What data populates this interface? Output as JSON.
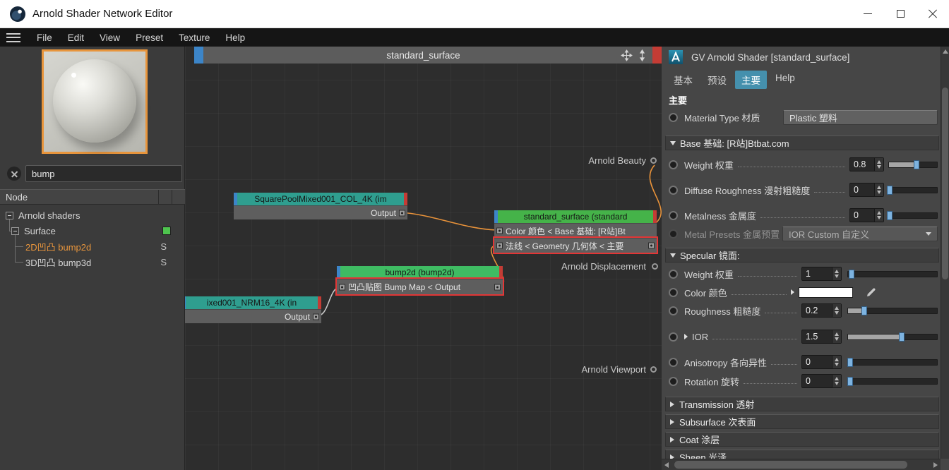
{
  "window": {
    "title": "Arnold Shader Network Editor"
  },
  "menu": {
    "items": [
      "File",
      "Edit",
      "View",
      "Preset",
      "Texture",
      "Help"
    ]
  },
  "left_panel": {
    "search_value": "bump",
    "tree_header": "Node",
    "tree": [
      {
        "label": "Arnold shaders"
      },
      {
        "label": "Surface",
        "swatch_color": "#4ec44e"
      },
      {
        "label": "2D凹凸 bump2d",
        "badge": "S",
        "color": "#e8953c"
      },
      {
        "label": "3D凹凸 bump3d",
        "badge": "S"
      }
    ]
  },
  "graph": {
    "header_title": "standard_surface",
    "nodes": {
      "color_tex": {
        "title": "SquarePoolMixed001_COL_4K (im",
        "output": "Output"
      },
      "standard_surface": {
        "title": "standard_surface (standard",
        "row_color": "Color 颜色 < Base 基础: [R站]Bt",
        "row_normal": "法线 < Geometry 几何体 < 主要"
      },
      "bump2d": {
        "title": "bump2d (bump2d)",
        "row": "凹凸贴图 Bump Map <  Output"
      },
      "normal_tex": {
        "title": "ixed001_NRM16_4K (in",
        "output": "Output"
      }
    },
    "outputs": [
      "Arnold Beauty",
      "Arnold Displacement",
      "Arnold Viewport"
    ]
  },
  "right_panel": {
    "title": "GV Arnold Shader [standard_surface]",
    "tabs": [
      "基本",
      "预设",
      "主要",
      "Help"
    ],
    "active_tab": "主要",
    "section_label": "主要",
    "material_type": {
      "label": "Material Type 材质",
      "value": "Plastic 塑料"
    },
    "base": {
      "title": "Base 基础: [R站]Btbat.com",
      "weight": {
        "label": "Weight 权重",
        "value": "0.8"
      },
      "diffuse_roughness": {
        "label": "Diffuse Roughness 漫射粗糙度",
        "value": "0"
      },
      "metalness": {
        "label": "Metalness 金属度",
        "value": "0"
      },
      "metal_presets": {
        "label": "Metal Presets 金属预置",
        "value": "IOR Custom 自定义"
      }
    },
    "specular": {
      "title": "Specular 镜面:",
      "weight": {
        "label": "Weight 权重",
        "value": "1"
      },
      "color": {
        "label": "Color 颜色",
        "swatch": "#ffffff"
      },
      "roughness": {
        "label": "Roughness 粗糙度",
        "value": "0.2"
      },
      "ior": {
        "label": "IOR",
        "value": "1.5"
      },
      "anisotropy": {
        "label": "Anisotropy 各向异性",
        "value": "0"
      },
      "rotation": {
        "label": "Rotation 旋转",
        "value": "0"
      }
    },
    "collapsed_sections": [
      "Transmission 透射",
      "Subsurface 次表面",
      "Coat 涂层",
      "Sheen 光泽"
    ]
  }
}
